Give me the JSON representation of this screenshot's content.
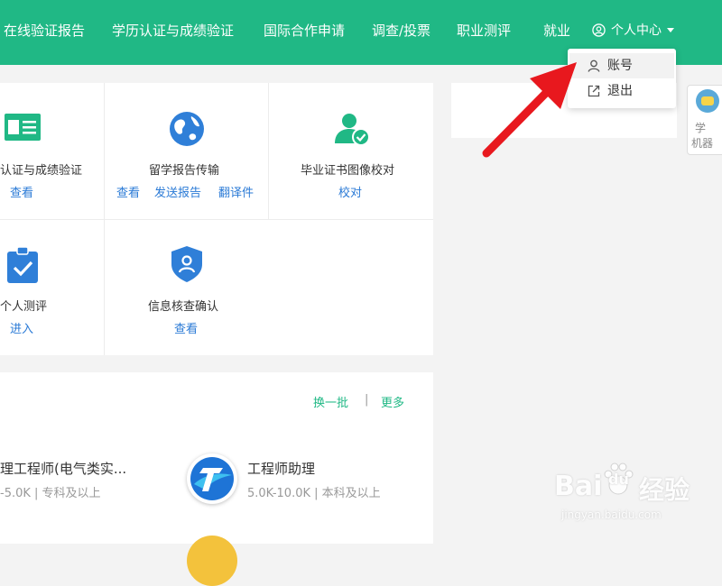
{
  "nav": {
    "items": [
      "在线验证报告",
      "学历认证与成绩验证",
      "国际合作申请",
      "调查/投票",
      "职业测评",
      "就业"
    ],
    "user_center": "个人中心"
  },
  "dropdown": {
    "account": "账号",
    "logout": "退出"
  },
  "services": {
    "cell1": {
      "title": "认证与成绩验证",
      "links": [
        "查看"
      ]
    },
    "cell2": {
      "title": "留学报告传输",
      "links": [
        "查看",
        "发送报告",
        "翻译件"
      ]
    },
    "cell3": {
      "title": "毕业证书图像校对",
      "links": [
        "校对"
      ]
    },
    "cell4": {
      "title": "个人测评",
      "links": [
        "进入"
      ]
    },
    "cell5": {
      "title": "信息核查确认",
      "links": [
        "查看"
      ]
    }
  },
  "side_widget": {
    "line1": "学",
    "line2": "机器"
  },
  "jobs": {
    "change_batch": "换一批",
    "separator": "|",
    "more": "更多",
    "items": [
      {
        "title": "理工程师(电气类实...",
        "meta": "-5.0K | 专科及以上"
      },
      {
        "title": "工程师助理",
        "meta": "5.0K-10.0K | 本科及以上"
      }
    ]
  },
  "watermark": {
    "brand": "Bai",
    "paw": "du",
    "suffix": "经验",
    "url": "jingyan.baidu.com"
  },
  "colors": {
    "nav_green": "#20b885",
    "link_blue": "#2a7ad6",
    "arrow_red": "#e8181e",
    "icon_green": "#20b885",
    "icon_blue": "#2f7fd8"
  }
}
